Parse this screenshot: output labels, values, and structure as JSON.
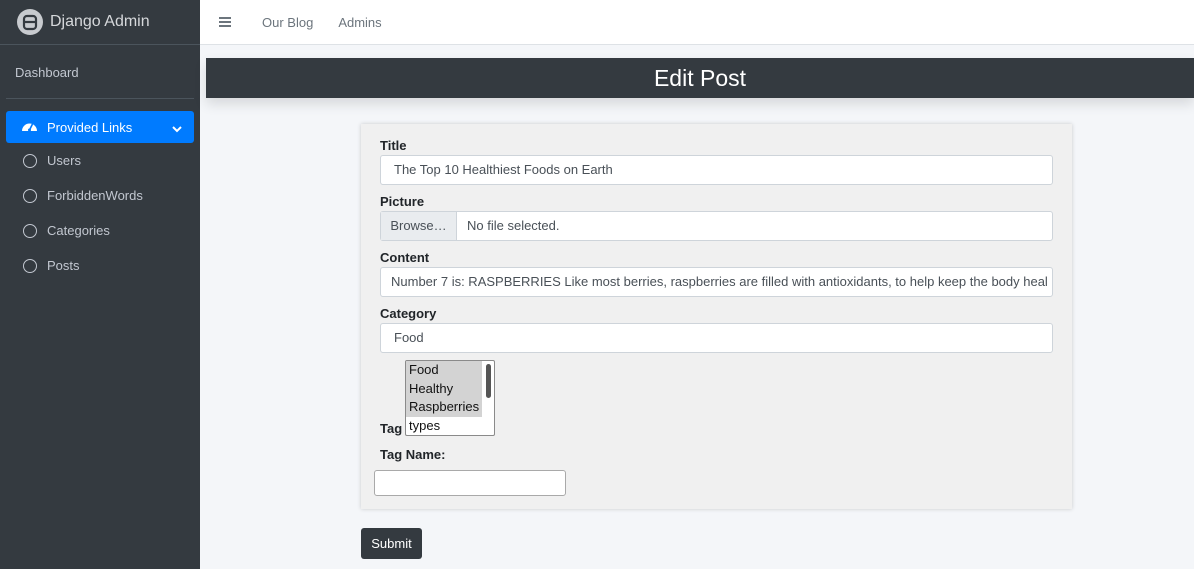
{
  "brand": {
    "title": "Django Admin",
    "logo_icon": "robot-logo-icon"
  },
  "sidebar": {
    "dashboard": "Dashboard",
    "group": {
      "label": "Provided Links",
      "icon": "tachometer-icon",
      "color": "#007bff"
    },
    "items": [
      {
        "label": "Users"
      },
      {
        "label": "ForbiddenWords"
      },
      {
        "label": "Categories"
      },
      {
        "label": "Posts"
      }
    ]
  },
  "topnav": {
    "links": [
      "Our Blog",
      "Admins"
    ]
  },
  "page": {
    "title": "Edit Post"
  },
  "form": {
    "title_label": "Title",
    "title_value": "The Top 10 Healthiest Foods on Earth",
    "picture_label": "Picture",
    "browse_label": "Browse…",
    "file_status": "No file selected.",
    "content_label": "Content",
    "content_value": "Number 7 is:  RASPBERRIES  Like most berries, raspberries are filled with antioxidants, to help keep the body heal",
    "category_label": "Category",
    "category_value": "Food",
    "tag_label": "Tag",
    "tag_options": [
      {
        "label": "Food",
        "selected": true
      },
      {
        "label": "Healthy",
        "selected": true
      },
      {
        "label": "Raspberries",
        "selected": true
      },
      {
        "label": "types",
        "selected": false
      }
    ],
    "tag_name_label": "Tag Name:",
    "tag_name_value": "",
    "submit_label": "Submit"
  }
}
